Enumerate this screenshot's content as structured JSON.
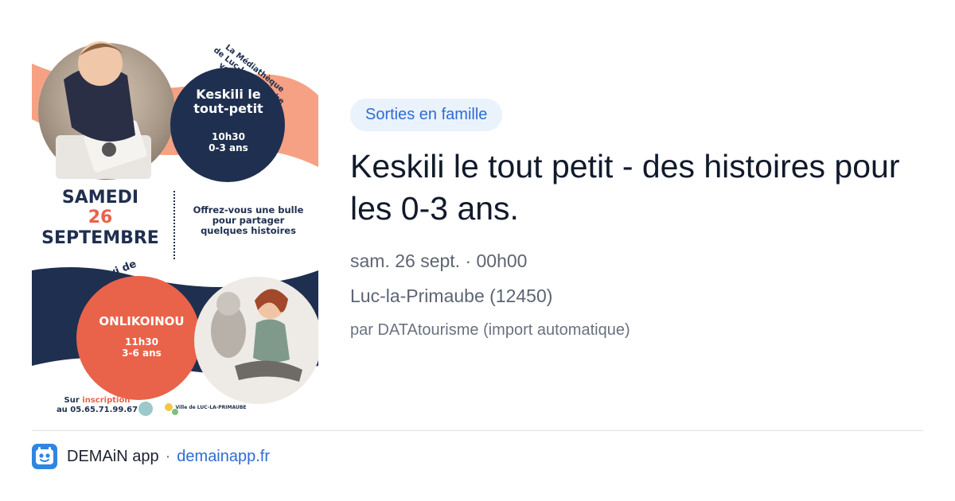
{
  "poster": {
    "organizer_line1": "La Médiathèque",
    "organizer_line2": "de Luc-la-Primaube",
    "organizer_line3": "vous propose",
    "event1_title_line1": "Keskili le",
    "event1_title_line2": "tout-petit",
    "event1_time": "10h30",
    "event1_age": "0-3 ans",
    "day": "SAMEDI",
    "date_num": "26",
    "month": "SEPTEMBRE",
    "offer_line1": "Offrez-vous une bulle",
    "offer_line2": "pour partager",
    "offer_line3": "quelques histoires",
    "followed_by": "Suivi de",
    "event2_title": "ONLIKOINOU",
    "event2_time": "11h30",
    "event2_age": "3-6 ans",
    "signup_prefix": "Sur",
    "signup_word": "inscription",
    "signup_phone": "au 05.65.71.99.67",
    "ville_logo": "Ville de LUC-LA-PRIMAUBE",
    "colors": {
      "navy": "#1f2f4f",
      "coral": "#e9624a",
      "peach": "#f6a184"
    }
  },
  "category_tag": "Sorties en famille",
  "title": "Keskili le tout petit - des histoires pour les 0-3 ans.",
  "date_time": "sam. 26 sept. · 00h00",
  "location": "Luc-la-Primaube (12450)",
  "source": "par DATAtourisme (import automatique)",
  "footer": {
    "app_name": "DEMAiN app",
    "separator": "·",
    "domain": "demainapp.fr",
    "app_icon": "demain-app-icon"
  },
  "colors": {
    "tag_bg": "#eaf2fc",
    "tag_text": "#2f6cd2",
    "title": "#111a2b",
    "meta": "#5d6573",
    "link": "#2f6cd2"
  }
}
